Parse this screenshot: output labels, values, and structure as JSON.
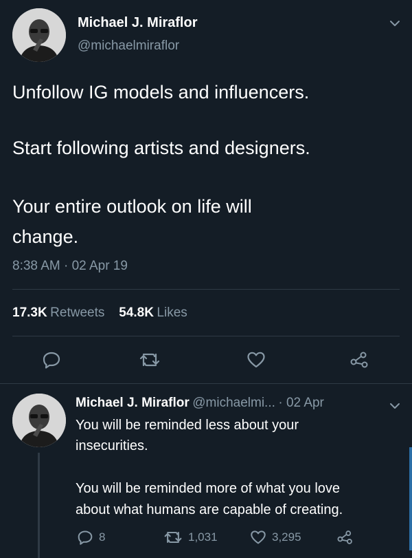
{
  "tweet": {
    "author_name": "Michael J. Miraflor",
    "author_handle": "@michaelmiraflor",
    "text_lines": [
      "Unfollow IG models and influencers.",
      "Start following artists and designers.",
      "Your entire outlook on life will",
      "change."
    ],
    "timestamp": "8:38 AM · 02 Apr 19",
    "retweets_count": "17.3K",
    "retweets_label": "Retweets",
    "likes_count": "54.8K",
    "likes_label": "Likes"
  },
  "reply": {
    "author_name": "Michael J. Miraflor",
    "author_handle": "@michaelmi...",
    "date": "· 02 Apr",
    "text_lines": [
      "You will be reminded less about your",
      "insecurities.",
      "You will be reminded more of what you love",
      "about what humans are capable of creating."
    ],
    "reply_count": "8",
    "retweet_count": "1,031",
    "like_count": "3,295"
  },
  "colors": {
    "background": "#141d26",
    "text": "#ffffff",
    "secondary_text": "#8899a6",
    "divider": "#2f3a45"
  },
  "icons": {
    "caret": "chevron-down-icon",
    "reply": "reply-icon",
    "retweet": "retweet-icon",
    "like": "heart-icon",
    "share": "share-icon"
  }
}
